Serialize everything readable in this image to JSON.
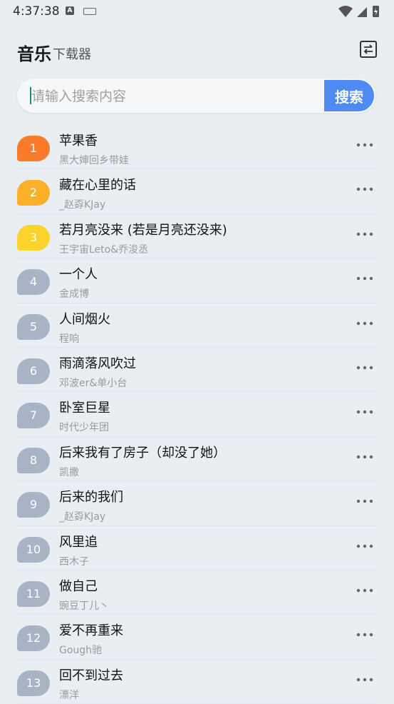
{
  "status_bar": {
    "time": "4:37:38",
    "a_label": "A"
  },
  "header": {
    "title_main": "音乐",
    "title_sub": "下载器"
  },
  "search": {
    "placeholder": "请输入搜索内容",
    "button_label": "搜索"
  },
  "badge_colors": {
    "1": "#f97b2b",
    "2": "#fbb02a",
    "3": "#fcd22c",
    "default": "#a8b4c6"
  },
  "songs": [
    {
      "rank": "1",
      "title": "苹果香",
      "artist": "黑大婶回乡带娃"
    },
    {
      "rank": "2",
      "title": "藏在心里的话",
      "artist": "_赵孬KJay"
    },
    {
      "rank": "3",
      "title": "若月亮没来 (若是月亮还没来)",
      "artist": "王宇宙Leto&乔浚丞"
    },
    {
      "rank": "4",
      "title": "一个人",
      "artist": "金成博"
    },
    {
      "rank": "5",
      "title": "人间烟火",
      "artist": "程响"
    },
    {
      "rank": "6",
      "title": "雨滴落风吹过",
      "artist": "邓波er&单小台"
    },
    {
      "rank": "7",
      "title": "卧室巨星",
      "artist": "时代少年团"
    },
    {
      "rank": "8",
      "title": "后来我有了房子（却没了她）",
      "artist": "凯撒"
    },
    {
      "rank": "9",
      "title": "后来的我们",
      "artist": "_赵孬KJay"
    },
    {
      "rank": "10",
      "title": "风里追",
      "artist": "西木子"
    },
    {
      "rank": "11",
      "title": "做自己",
      "artist": "豌豆丁儿丶"
    },
    {
      "rank": "12",
      "title": "爱不再重来",
      "artist": "Gough驰"
    },
    {
      "rank": "13",
      "title": "回不到过去",
      "artist": "漂洋"
    }
  ]
}
